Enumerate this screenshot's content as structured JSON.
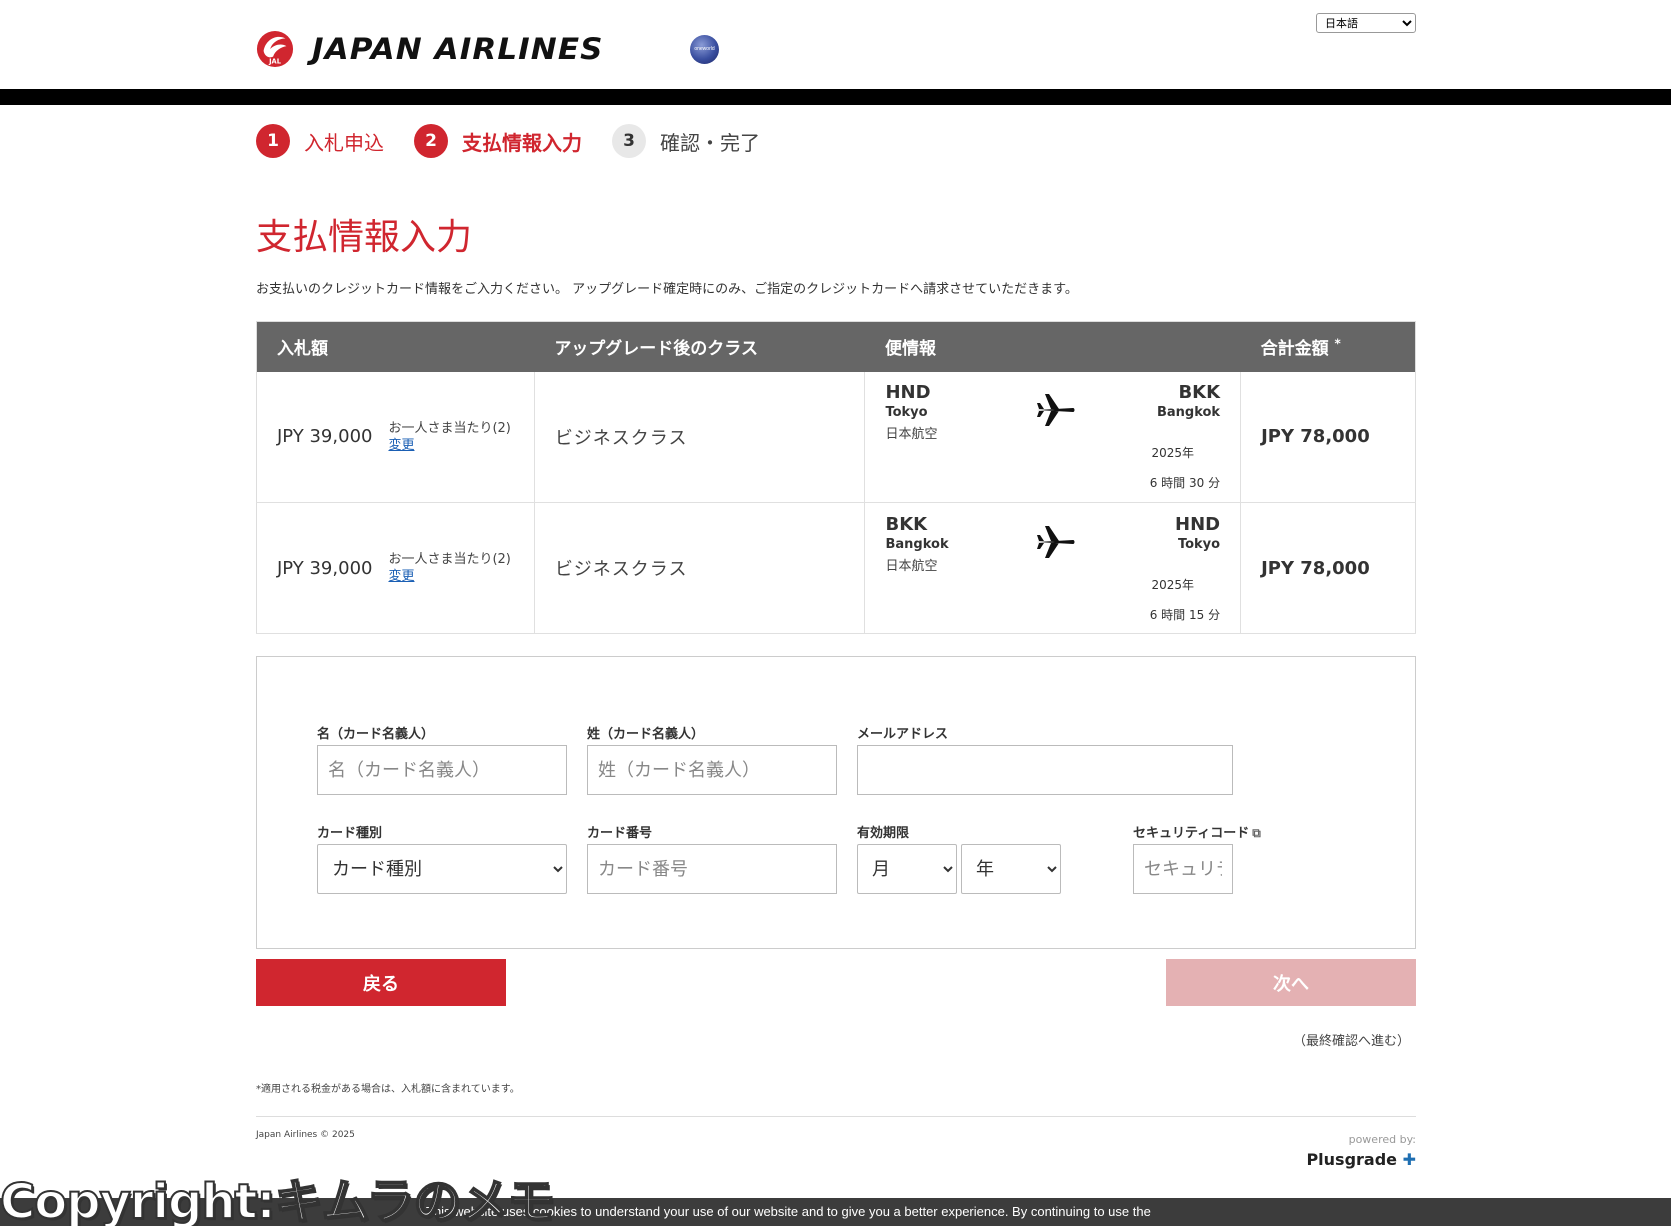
{
  "header": {
    "brand": "JAPAN AIRLINES",
    "logo_mark": "JAL",
    "alliance_badge": "oneworld",
    "language": "日本語"
  },
  "steps": [
    {
      "num": "1",
      "label": "入札申込"
    },
    {
      "num": "2",
      "label": "支払情報入力"
    },
    {
      "num": "3",
      "label": "確認・完了"
    }
  ],
  "page": {
    "title": "支払情報入力",
    "description": "お支払いのクレジットカード情報をご入力ください。 アップグレード確定時にのみ、ご指定のクレジットカードへ請求させていただきます。"
  },
  "table": {
    "headers": {
      "bid": "入札額",
      "class": "アップグレード後のクラス",
      "flight": "便情報",
      "total": "合計金額",
      "total_mark": "*"
    },
    "rows": [
      {
        "bid_amount": "JPY 39,000",
        "bid_note": "お一人さま当たり(2)",
        "change": "変更",
        "class": "ビジネスクラス",
        "origin_code": "HND",
        "origin_city": "Tokyo",
        "airline": "日本航空",
        "dest_code": "BKK",
        "dest_city": "Bangkok",
        "year": "2025年",
        "duration": "6 時間 30 分",
        "total": "JPY 78,000"
      },
      {
        "bid_amount": "JPY 39,000",
        "bid_note": "お一人さま当たり(2)",
        "change": "変更",
        "class": "ビジネスクラス",
        "origin_code": "BKK",
        "origin_city": "Bangkok",
        "airline": "日本航空",
        "dest_code": "HND",
        "dest_city": "Tokyo",
        "year": "2025年",
        "duration": "6 時間 15 分",
        "total": "JPY 78,000"
      }
    ]
  },
  "form": {
    "first_name": {
      "label": "名（カード名義人）",
      "placeholder": "名（カード名義人）"
    },
    "last_name": {
      "label": "姓（カード名義人）",
      "placeholder": "姓（カード名義人）"
    },
    "email": {
      "label": "メールアドレス",
      "placeholder": ""
    },
    "card_type": {
      "label": "カード種別",
      "value": "カード種別"
    },
    "card_number": {
      "label": "カード番号",
      "placeholder": "カード番号"
    },
    "expiry": {
      "label": "有効期限",
      "month": "月",
      "year": "年"
    },
    "security_code": {
      "label": "セキュリティコード",
      "placeholder": "セキュリティコード"
    }
  },
  "buttons": {
    "back": "戻る",
    "next": "次へ",
    "next_note": "（最終確認へ進む）"
  },
  "footer": {
    "tax_note": "*適用される税金がある場合は、入札額に含まれています。",
    "copyright": "Japan Airlines © 2025",
    "powered_by": "powered by:",
    "plusgrade": "Plusgrade"
  },
  "watermark": "Copyright:キムラのメモ",
  "cookie": "This website uses cookies to understand your use of our website and to give you a better experience. By continuing to use the",
  "colors": {
    "brand_red": "#d0262f",
    "header_gray": "#666666",
    "disabled_button": "#e4b1b3",
    "link_blue": "#1a5fb4"
  }
}
